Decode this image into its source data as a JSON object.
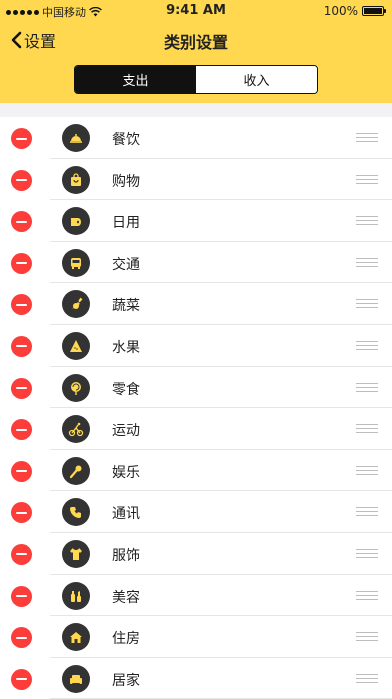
{
  "status_bar": {
    "carrier": "中国移动",
    "time": "9:41 AM",
    "battery": "100%"
  },
  "nav": {
    "back_label": "设置",
    "title": "类别设置"
  },
  "segment": {
    "expense": "支出",
    "income": "收入"
  },
  "categories": [
    {
      "label": "餐饮",
      "icon": "dining-cloche-icon"
    },
    {
      "label": "购物",
      "icon": "shopping-bag-icon"
    },
    {
      "label": "日用",
      "icon": "tissue-roll-icon"
    },
    {
      "label": "交通",
      "icon": "bus-icon"
    },
    {
      "label": "蔬菜",
      "icon": "vegetable-icon"
    },
    {
      "label": "水果",
      "icon": "watermelon-slice-icon"
    },
    {
      "label": "零食",
      "icon": "lollipop-icon"
    },
    {
      "label": "运动",
      "icon": "cyclist-icon"
    },
    {
      "label": "娱乐",
      "icon": "microphone-icon"
    },
    {
      "label": "通讯",
      "icon": "phone-icon"
    },
    {
      "label": "服饰",
      "icon": "tshirt-icon"
    },
    {
      "label": "美容",
      "icon": "cosmetics-icon"
    },
    {
      "label": "住房",
      "icon": "house-icon"
    },
    {
      "label": "居家",
      "icon": "sofa-icon"
    }
  ],
  "colors": {
    "header": "#FFD84F",
    "delete": "#FC3D39",
    "icon_circle": "#333333",
    "icon_glyph": "#FFD84F"
  }
}
